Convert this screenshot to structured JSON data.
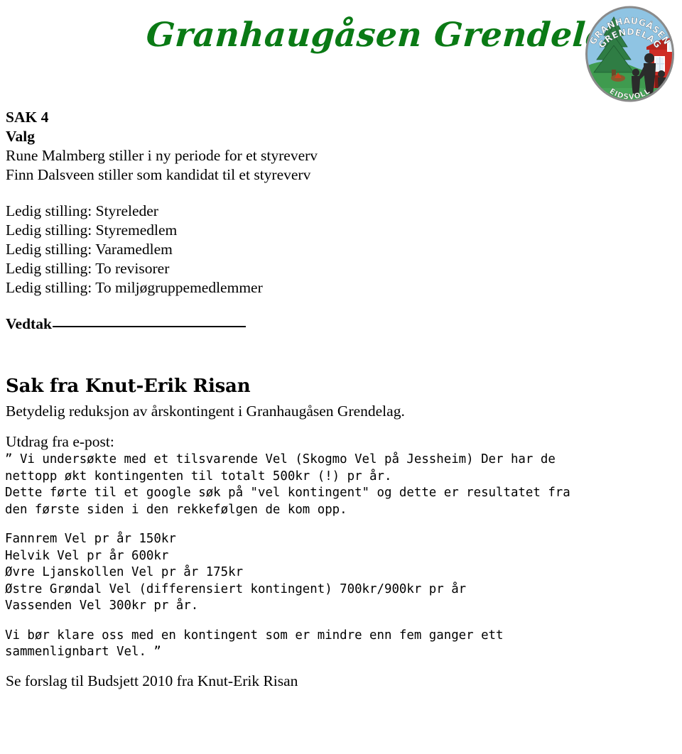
{
  "header": {
    "org_title": "Granhaugåsen Grendelag",
    "logo": {
      "name": "granhaugasen-grendelag-emblem",
      "top_text_line1": "GRANHAUGÅSEN",
      "top_text_line2": "GRENDELAG",
      "bottom_text": "EIDSVOLL",
      "colors": {
        "sky": "#8fc4e3",
        "grass": "#3f9b4f",
        "tree": "#2f7d44",
        "house": "#cf2e26",
        "border": "#8a8a8a",
        "figure": "#2b2b2b",
        "text": "#ffffff"
      }
    }
  },
  "document": {
    "sak4": {
      "number_label": "SAK 4",
      "title": "Valg",
      "candidates": [
        "Rune Malmberg stiller i ny periode for et styreverv",
        "Finn Dalsveen stiller som kandidat til et styreverv"
      ],
      "vacancies": [
        "Ledig stilling: Styreleder",
        "Ledig stilling: Styremedlem",
        "Ledig stilling: Varamedlem",
        "Ledig stilling: To revisorer",
        "Ledig stilling: To miljøgruppemedlemmer"
      ],
      "vedtak_label": "Vedtak"
    },
    "sak_risan": {
      "heading": "Sak fra Knut-Erik Risan",
      "subheading": "Betydelig reduksjon av årskontingent i Granhaugåsen Grendelag.",
      "excerpt_label": "Utdrag fra e-post:",
      "quote_paragraph_1": [
        "” Vi undersøkte med et tilsvarende Vel (Skogmo Vel på Jessheim) Der har de",
        "nettopp økt kontingenten til totalt 500kr (!) pr år.",
        "Dette førte til et google søk på \"vel kontingent\" og dette er resultatet fra",
        "den første siden i den rekkefølgen de kom opp."
      ],
      "vel_list": [
        "Fannrem Vel pr år 150kr",
        "Helvik Vel pr år 600kr",
        "Øvre Ljanskollen Vel pr år 175kr",
        "Østre Grøndal Vel (differensiert kontingent) 700kr/900kr pr år",
        "Vassenden Vel 300kr pr år."
      ],
      "quote_paragraph_2": [
        "Vi bør klare oss med en kontingent som er mindre enn fem ganger ett",
        "sammenlignbart Vel. ”"
      ],
      "footer_note": "Se forslag til Budsjett 2010 fra Knut-Erik Risan"
    }
  }
}
